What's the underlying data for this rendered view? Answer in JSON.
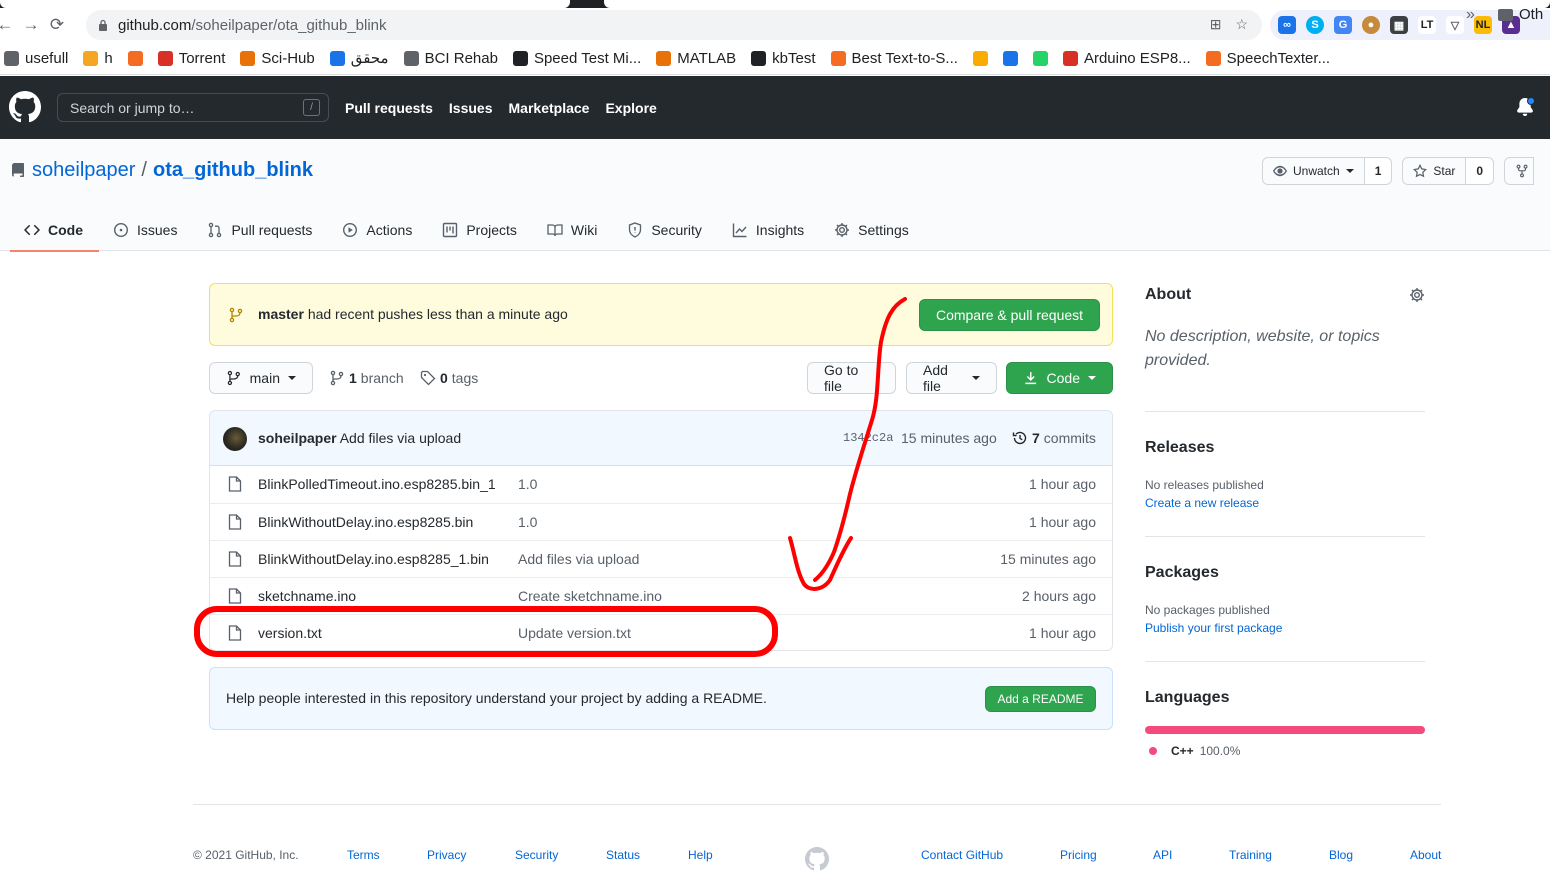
{
  "browser": {
    "url_host": "github.com",
    "url_path": "/soheilpaper/ota_github_blink",
    "bookmarks": [
      {
        "label": "usefull",
        "color": "#5f6368"
      },
      {
        "label": "h",
        "color": "#f5a623"
      },
      {
        "label": "",
        "color": "#f36c21"
      },
      {
        "label": "Torrent",
        "color": "#d93025"
      },
      {
        "label": "Sci-Hub",
        "color": "#e8710a"
      },
      {
        "label": "محقق",
        "color": "#1a73e8"
      },
      {
        "label": "BCI Rehab",
        "color": "#5f6368"
      },
      {
        "label": "Speed Test Mi...",
        "color": "#202124"
      },
      {
        "label": "MATLAB",
        "color": "#e8710a"
      },
      {
        "label": "kbTest",
        "color": "#202124"
      },
      {
        "label": "Best Text-to-S...",
        "color": "#f36c21"
      },
      {
        "label": "",
        "color": "#f9ab00"
      },
      {
        "label": "",
        "color": "#1a73e8"
      },
      {
        "label": "",
        "color": "#25d366"
      },
      {
        "label": "Arduino ESP8...",
        "color": "#d93025"
      },
      {
        "label": "SpeechTexter...",
        "color": "#f36c21"
      }
    ],
    "bookmarks_more": "»",
    "bookmarks_other": "Oth"
  },
  "header": {
    "search_placeholder": "Search or jump to…",
    "slash_key": "/",
    "nav": [
      "Pull requests",
      "Issues",
      "Marketplace",
      "Explore"
    ]
  },
  "repo": {
    "owner": "soheilpaper",
    "separator": "/",
    "name": "ota_github_blink",
    "unwatch_label": "Unwatch",
    "watch_count": "1",
    "star_label": "Star",
    "star_count": "0",
    "tabs": [
      {
        "label": "Code",
        "icon": "code-icon"
      },
      {
        "label": "Issues",
        "icon": "issue-icon"
      },
      {
        "label": "Pull requests",
        "icon": "pull-request-icon"
      },
      {
        "label": "Actions",
        "icon": "play-icon"
      },
      {
        "label": "Projects",
        "icon": "project-icon"
      },
      {
        "label": "Wiki",
        "icon": "book-icon"
      },
      {
        "label": "Security",
        "icon": "shield-icon"
      },
      {
        "label": "Insights",
        "icon": "graph-icon"
      },
      {
        "label": "Settings",
        "icon": "gear-icon"
      }
    ]
  },
  "banner": {
    "branch": "master",
    "message": "had recent pushes less than a minute ago",
    "button": "Compare & pull request"
  },
  "file_nav": {
    "branch": "main",
    "branch_count": "1",
    "branch_label": "branch",
    "tag_count": "0",
    "tag_label": "tags",
    "goto_file": "Go to file",
    "add_file": "Add file",
    "code": "Code"
  },
  "latest_commit": {
    "author": "soheilpaper",
    "message": "Add files via upload",
    "sha": "1342c2a",
    "time": "15 minutes ago",
    "commit_count": "7",
    "commit_label": "commits"
  },
  "files": [
    {
      "name": "BlinkPolledTimeout.ino.esp8285.bin_1",
      "message": "1.0",
      "age": "1 hour ago"
    },
    {
      "name": "BlinkWithoutDelay.ino.esp8285.bin",
      "message": "1.0",
      "age": "1 hour ago"
    },
    {
      "name": "BlinkWithoutDelay.ino.esp8285_1.bin",
      "message": "Add files via upload",
      "age": "15 minutes ago"
    },
    {
      "name": "sketchname.ino",
      "message": "Create sketchname.ino",
      "age": "2 hours ago"
    },
    {
      "name": "version.txt",
      "message": "Update version.txt",
      "age": "1 hour ago"
    }
  ],
  "readme": {
    "text": "Help people interested in this repository understand your project by adding a README.",
    "button": "Add a README"
  },
  "sidebar": {
    "about_title": "About",
    "about_desc": "No description, website, or topics provided.",
    "releases_title": "Releases",
    "releases_none": "No releases published",
    "releases_link": "Create a new release",
    "packages_title": "Packages",
    "packages_none": "No packages published",
    "packages_link": "Publish your first package",
    "languages_title": "Languages",
    "language_name": "C++",
    "language_pct": "100.0%",
    "language_share": 1.0,
    "language_color": "#f34b7d"
  },
  "footer": {
    "copyright": "© 2021 GitHub, Inc.",
    "links": [
      "Terms",
      "Privacy",
      "Security",
      "Status",
      "Help",
      "Contact GitHub",
      "Pricing",
      "API",
      "Training",
      "Blog",
      "About"
    ]
  },
  "colors": {
    "header_bg": "#24292e",
    "link": "#0366d6",
    "primary_green": "#2ea44f",
    "annotation_red": "#ff0000"
  }
}
